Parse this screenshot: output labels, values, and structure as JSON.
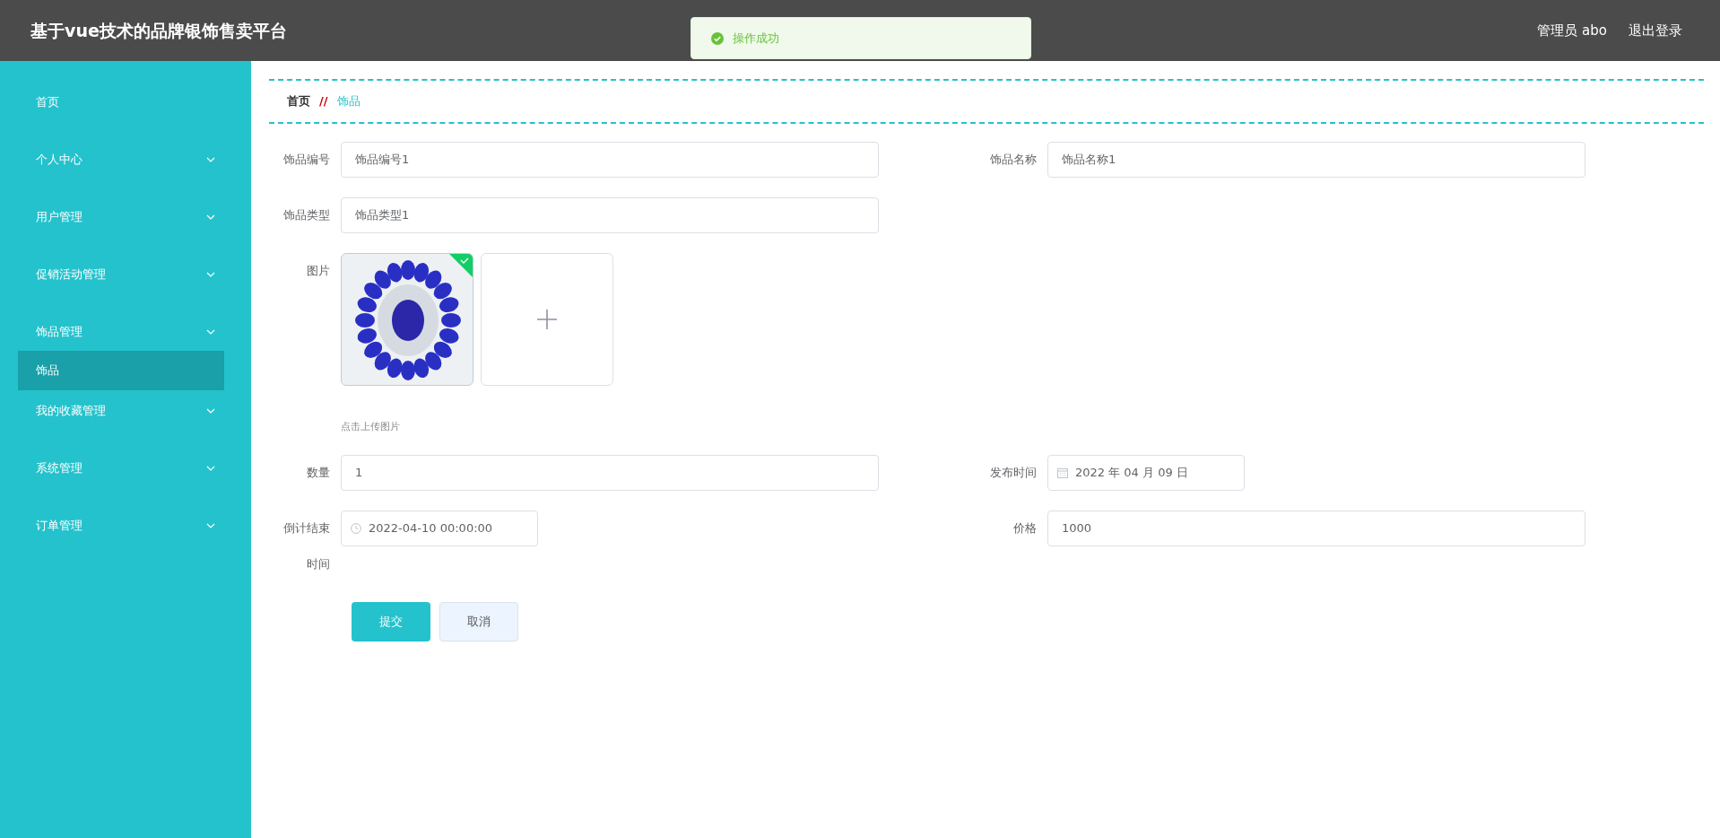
{
  "header": {
    "title": "基于vue技术的品牌银饰售卖平台",
    "user": "管理员 abo",
    "logout": "退出登录"
  },
  "toast": {
    "message": "操作成功"
  },
  "sidebar": {
    "items": [
      {
        "label": "首页",
        "kind": "link",
        "selected": false
      },
      {
        "label": "个人中心",
        "kind": "submenu",
        "selected": false
      },
      {
        "label": "用户管理",
        "kind": "submenu",
        "selected": false
      },
      {
        "label": "促销活动管理",
        "kind": "submenu",
        "selected": false
      },
      {
        "label": "饰品管理",
        "kind": "submenu",
        "selected": false,
        "children": [
          {
            "label": "饰品",
            "selected": true
          }
        ]
      },
      {
        "label": "我的收藏管理",
        "kind": "submenu",
        "selected": false
      },
      {
        "label": "系统管理",
        "kind": "submenu",
        "selected": false
      },
      {
        "label": "订单管理",
        "kind": "submenu",
        "selected": false
      }
    ]
  },
  "breadcrumb": {
    "separator": "//",
    "items": [
      {
        "label": "首页",
        "selected": false
      },
      {
        "label": "饰品",
        "selected": true
      }
    ]
  },
  "form": {
    "rows": [
      {
        "fields": [
          {
            "kind": "text",
            "label": "饰品编号",
            "value": "饰品编号1"
          },
          {
            "kind": "text",
            "label": "饰品名称",
            "value": "饰品名称1"
          }
        ]
      },
      {
        "fields": [
          {
            "kind": "text",
            "label": "饰品类型",
            "value": "饰品类型1"
          }
        ]
      },
      {
        "fields": [
          {
            "kind": "image",
            "label": "图片",
            "uploaded": true,
            "hint": "点击上传图片"
          }
        ]
      },
      {
        "fields": [
          {
            "kind": "text",
            "label": "数量",
            "value": "1"
          },
          {
            "kind": "date",
            "label": "发布时间",
            "value": "2022 年 04 月 09 日"
          }
        ]
      },
      {
        "fields": [
          {
            "kind": "datetime",
            "label": "倒计结束时间",
            "value": "2022-04-10 00:00:00"
          },
          {
            "kind": "text",
            "label": "价格",
            "value": "1000"
          }
        ]
      }
    ],
    "buttons": [
      {
        "label": "提交",
        "kind": "primary"
      },
      {
        "label": "取消",
        "kind": "secondary"
      }
    ]
  }
}
